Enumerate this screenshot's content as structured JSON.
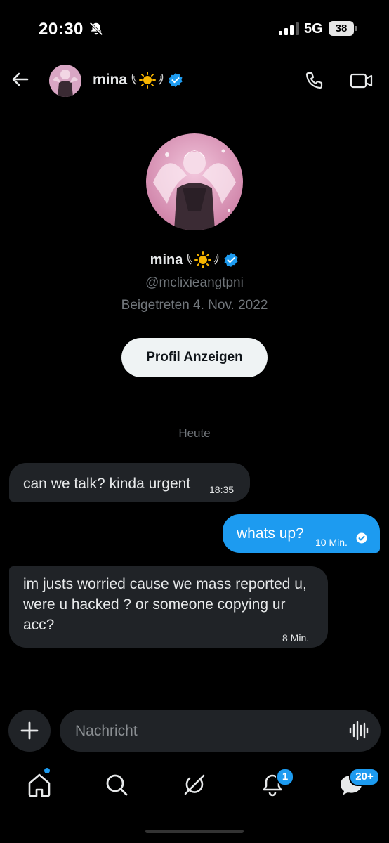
{
  "status_bar": {
    "time": "20:30",
    "network": "5G",
    "battery": "38"
  },
  "header": {
    "name": "mina"
  },
  "profile": {
    "name": "mina",
    "handle": "@mclixieangtpni",
    "joined": "Beigetreten 4. Nov. 2022",
    "view_profile_label": "Profil Anzeigen"
  },
  "date_separator": "Heute",
  "messages": [
    {
      "direction": "incoming",
      "text": "can we talk? kinda urgent",
      "time": "18:35"
    },
    {
      "direction": "outgoing",
      "text": "whats up?",
      "time": "10 Min.",
      "read": true
    },
    {
      "direction": "incoming",
      "text": "im justs worried cause we mass reported u, were u hacked ? or someone copying ur acc?",
      "time": "8 Min."
    }
  ],
  "composer": {
    "placeholder": "Nachricht"
  },
  "tabbar": {
    "notifications_badge": "1",
    "messages_badge": "20+"
  },
  "colors": {
    "accent": "#1d9bf0",
    "background": "#000000",
    "bubble_incoming": "#202327"
  },
  "icons": [
    "bell-slash-icon",
    "back-arrow-icon",
    "verified-badge-icon",
    "phone-icon",
    "video-icon",
    "plus-icon",
    "voice-wave-icon",
    "home-icon",
    "search-icon",
    "grok-icon",
    "bell-icon",
    "messages-icon",
    "read-check-icon"
  ]
}
